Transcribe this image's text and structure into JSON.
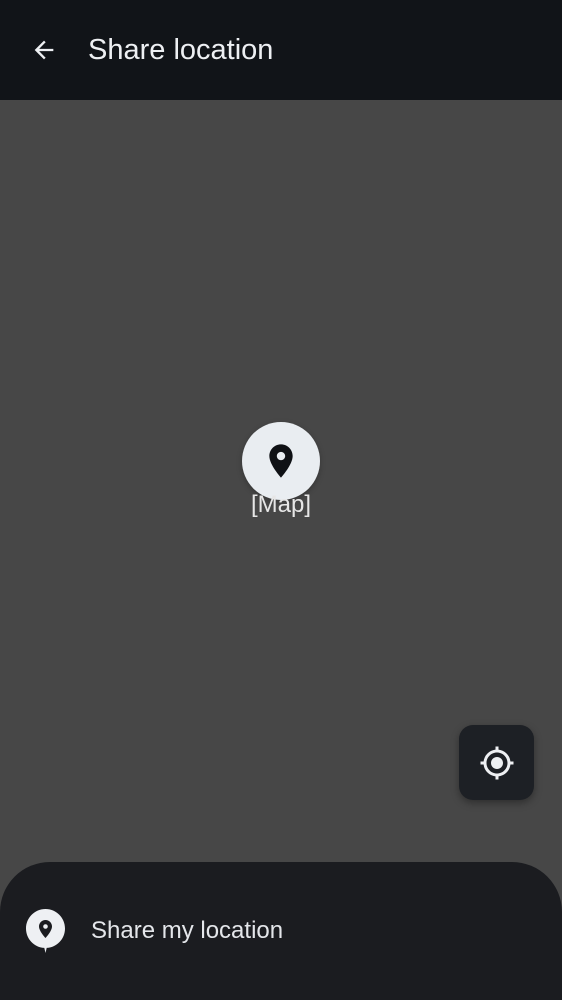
{
  "topbar": {
    "back_icon": "arrow-left-icon",
    "title": "Share location"
  },
  "map": {
    "placeholder": "[Map]",
    "pin_icon": "map-pin-icon",
    "locate_icon": "my-location-crosshair-icon"
  },
  "sheet": {
    "share_icon": "location-bubble-icon",
    "share_label": "Share my location"
  },
  "colors": {
    "topbar_bg": "#111418",
    "map_bg": "#474747",
    "sheet_bg": "#1b1c20",
    "text_primary": "#eef0f3",
    "pin_bg": "#e9edf1"
  }
}
